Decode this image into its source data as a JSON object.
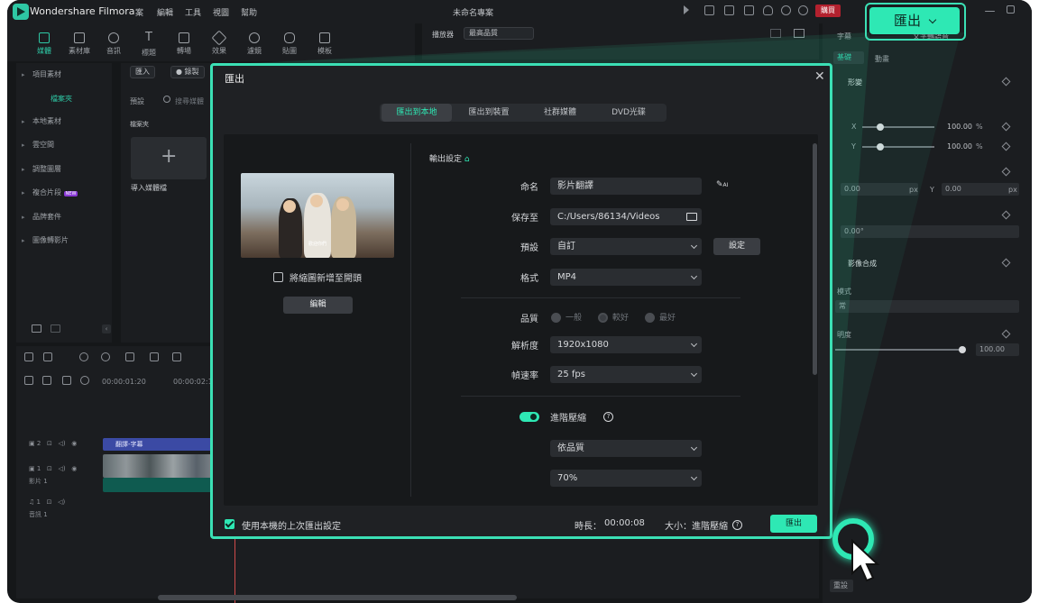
{
  "app": {
    "name": "Wondershare Filmora",
    "menu": [
      "案",
      "編輯",
      "工具",
      "視圖",
      "幫助"
    ],
    "project_title": "未命名專案",
    "buy_label": "購買"
  },
  "toolbar": {
    "items": [
      "媒體",
      "素材庫",
      "音訊",
      "標題",
      "轉場",
      "效果",
      "濾鏡",
      "貼圖",
      "模板"
    ]
  },
  "sidebar": {
    "items": [
      "項目素材",
      "本地素材",
      "雲空間",
      "調整圖層",
      "複合片段",
      "品牌套件",
      "圖像轉影片"
    ],
    "selected": "檔案夾",
    "new_badge": "NEW"
  },
  "media": {
    "import_label": "匯入",
    "record_label": "錄製",
    "preset_label": "預設",
    "search_placeholder": "搜尋媒體",
    "folder_label": "檔案夾",
    "import_tile_label": "導入媒體檔"
  },
  "preview": {
    "player_label": "播放器",
    "quality_label": "最高品質"
  },
  "timeline": {
    "ruler": [
      "00:00:01:20",
      "00:00:02:15"
    ],
    "track_title_label": "翻譯-字幕",
    "track_video_label": "影片 1",
    "track_audio_label": "音訊 1"
  },
  "right_panel": {
    "tabs": [
      "字幕",
      "",
      "文字轉語音"
    ],
    "sub_tabs": [
      "基礎",
      "動畫"
    ],
    "transform_label": "形變",
    "x_label": "X",
    "y_label": "Y",
    "x_value": "100.00",
    "y_value": "100.00",
    "percent": "%",
    "pos_x": "0.00",
    "pos_y": "0.00",
    "px": "px",
    "rotate": "0.00°",
    "compositing_label": "影像合成",
    "blend_mode_label": "模式",
    "blend_value": "常",
    "opacity_label": "明度",
    "opacity_value": "100.00",
    "reset_label": "重設"
  },
  "callout": {
    "export_label": "匯出"
  },
  "dialog": {
    "title": "匯出",
    "tabs": [
      "匯出到本地",
      "匯出到裝置",
      "社群媒體",
      "DVD光碟"
    ],
    "active_tab": 0,
    "add_thumbnail_label": "將縮圖新增至開頭",
    "thumbnail_caption": "歡迎你們",
    "edit_label": "編輯",
    "settings_header": "輸出設定",
    "name_label": "命名",
    "name_value": "影片翻譯",
    "ai_label": "AI",
    "save_to_label": "保存至",
    "save_to_value": "C:/Users/86134/Videos",
    "preset_label": "預設",
    "preset_value": "自訂",
    "settings_button": "設定",
    "format_label": "格式",
    "format_value": "MP4",
    "quality_label": "品質",
    "quality_options": [
      "一般",
      "較好",
      "最好"
    ],
    "quality_selected": 1,
    "resolution_label": "解析度",
    "resolution_value": "1920x1080",
    "framerate_label": "幀速率",
    "framerate_value": "25 fps",
    "advanced_label": "進階壓縮",
    "advanced_on": true,
    "compress_mode_value": "依品質",
    "compress_percent_value": "70%",
    "use_last_settings_label": "使用本機的上次匯出設定",
    "duration_label": "時長：",
    "duration_value": "00:00:08",
    "size_label": "大小：進階壓縮",
    "export_button": "匯出"
  },
  "colors": {
    "accent": "#2ee8b4",
    "dialog_bg": "#1f2124",
    "app_bg": "#151719"
  }
}
